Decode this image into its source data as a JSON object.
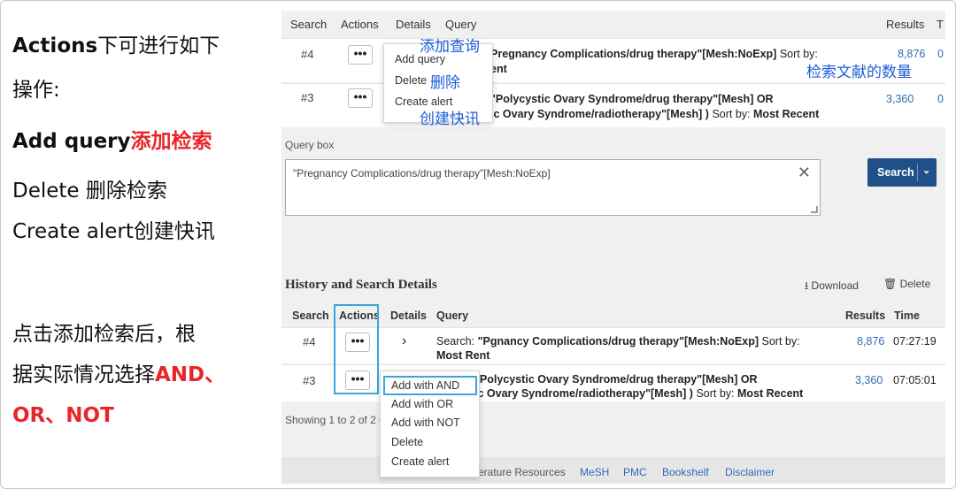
{
  "explanation": {
    "line1_a": "Actions",
    "line1_b": "下可进行如下",
    "line2": "操作:",
    "line3_a": "Add query",
    "line3_b": "添加检索",
    "line4": "Delete 删除检索",
    "line5": "Create alert创建快讯",
    "line6": "点击添加检索后，根",
    "line7_a": "据实际情况选择",
    "line7_b": "AND、",
    "line8": "OR、NOT"
  },
  "top_table": {
    "headers": [
      "Search",
      "Actions",
      "Details",
      "Query",
      "Results",
      "T"
    ],
    "rows": [
      {
        "num": "#4",
        "dots": "•••",
        "query_line1": "Pregnancy Complications/drug therapy\"[Mesh:NoExp]",
        "query_sortby": "Sort by:",
        "query_line2": "ent",
        "results": "8,876",
        "time_frag": "0"
      },
      {
        "num": "#3",
        "dots": "•••",
        "query_line1": "\"Polycystic Ovary Syndrome/drug therapy\"[Mesh] OR",
        "query_line2": "ic Ovary Syndrome/radiotherapy\"[Mesh] )",
        "query_sortby": "Sort by:",
        "query_sort_value": "Most Recent",
        "results": "3,360",
        "time_frag": "0"
      }
    ],
    "menu": [
      "Add query",
      "Delete",
      "Create alert"
    ]
  },
  "annotations": {
    "add_query": "添加查询",
    "delete": "删除",
    "create_alert": "创建快讯",
    "result_count": "检索文献的数量"
  },
  "query_box": {
    "label": "Query box",
    "value": "\"Pregnancy Complications/drug therapy\"[Mesh:NoExp]",
    "clear": "✕",
    "search_label": "Search",
    "search_chevron": "⌄"
  },
  "history": {
    "title": "History and Search Details",
    "download_icon": "⭳",
    "download_label": "Download",
    "delete_icon": "🗑",
    "delete_label": "Delete",
    "headers": [
      "Search",
      "Actions",
      "Details",
      "Query",
      "Results",
      "Time"
    ],
    "rows": [
      {
        "num": "#4",
        "dots": "•••",
        "chev": "›",
        "search_prefix": "Search:",
        "q1": "\"P",
        "q1b": "gnancy Complications/drug therapy\"[Mesh:NoExp]",
        "sortby": "Sort by:",
        "q2": "Most Re",
        "q2b": "nt",
        "results": "8,876",
        "time": "07:27:19"
      },
      {
        "num": "#3",
        "dots": "•••",
        "q1": "\"Polycystic Ovary Syndrome/drug therapy\"[Mesh] OR",
        "q2": "ic Ovary Syndrome/radiotherapy\"[Mesh] )",
        "sortby": "Sort by:",
        "sort_value": "Most Recent",
        "results": "3,360",
        "time": "07:05:01"
      }
    ],
    "menu": [
      "Add with AND",
      "Add with OR",
      "Add with NOT",
      "Delete",
      "Create alert"
    ],
    "showing": "Showing 1 to 2 of 2 e"
  },
  "footer": {
    "links": [
      "erature Resources",
      "MeSH",
      "PMC",
      "Bookshelf",
      "Disclaimer"
    ]
  },
  "colors": {
    "red_emphasis": "#e8262a",
    "annotation_blue": "#1e5fd6",
    "link_blue": "#2f6bb3",
    "search_button": "#20508a",
    "highlight_box": "#37a6d9"
  }
}
